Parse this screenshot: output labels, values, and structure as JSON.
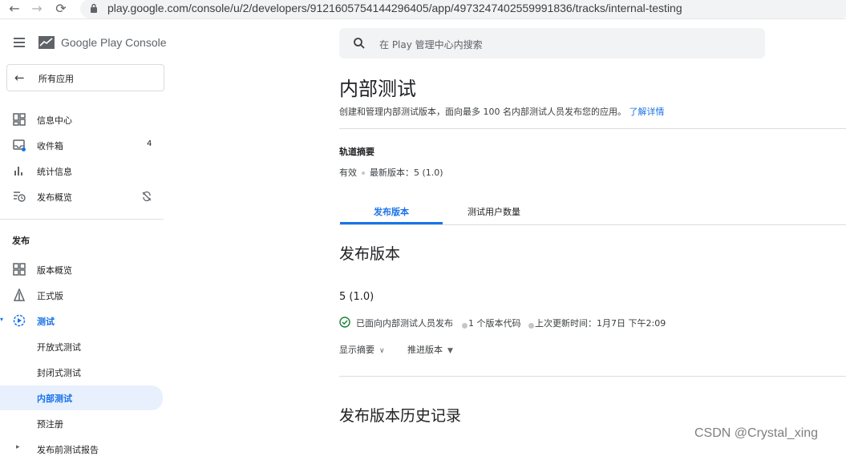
{
  "browser": {
    "url": "play.google.com/console/u/2/developers/9121605754144296405/app/4973247402559991836/tracks/internal-testing"
  },
  "sidebar": {
    "logo_text": "Google Play Console",
    "all_apps": "所有应用",
    "items": [
      {
        "label": "信息中心",
        "icon": "dashboard-icon"
      },
      {
        "label": "收件箱",
        "icon": "inbox-icon",
        "badge": "4"
      },
      {
        "label": "统计信息",
        "icon": "bar-chart-icon"
      },
      {
        "label": "发布概览",
        "icon": "publishing-overview-icon"
      }
    ],
    "section_header": "发布",
    "release_items": [
      {
        "label": "版本概览",
        "icon": "releases-overview-icon"
      },
      {
        "label": "正式版",
        "icon": "production-icon"
      },
      {
        "label": "测试",
        "icon": "testing-icon"
      }
    ],
    "testing_sub_items": [
      {
        "label": "开放式测试"
      },
      {
        "label": "封闭式测试"
      },
      {
        "label": "内部测试"
      },
      {
        "label": "预注册"
      },
      {
        "label": "发布前测试报告"
      }
    ]
  },
  "search": {
    "placeholder": "在 Play 管理中心内搜索"
  },
  "page": {
    "title": "内部测试",
    "description": "创建和管理内部测试版本，面向最多 100 名内部测试人员发布您的应用。",
    "learn_more": "了解详情",
    "track_summary_label": "轨道摘要",
    "track_status": "有效",
    "latest_version": "最新版本：5 (1.0)",
    "tabs": [
      {
        "label": "发布版本",
        "active": true
      },
      {
        "label": "测试用户数量",
        "active": false
      }
    ],
    "releases_heading": "发布版本",
    "release": {
      "version": "5 (1.0)",
      "status": "已面向内部测试人员发布",
      "version_codes": "1 个版本代码",
      "last_updated": "上次更新时间：1月7日 下午2:09",
      "show_summary": "显示摘要",
      "promote": "推进版本"
    },
    "history_heading": "发布版本历史记录"
  },
  "watermark": "CSDN @Crystal_xing",
  "colors": {
    "accent": "#1a73e8",
    "success": "#188038",
    "active_bg": "#e8f0fe"
  }
}
